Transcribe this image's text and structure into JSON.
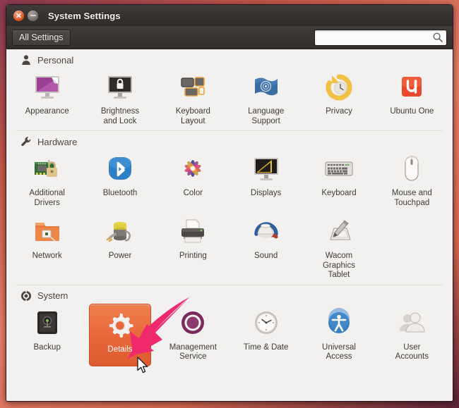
{
  "window": {
    "title": "System Settings",
    "close_label": "Close",
    "minimize_label": "Minimize"
  },
  "toolbar": {
    "all_settings_label": "All Settings",
    "search_value": "",
    "search_placeholder": "",
    "search_icon": "search-icon"
  },
  "sections": [
    {
      "id": "personal",
      "title": "Personal",
      "icon": "person-icon",
      "items": [
        {
          "label": "Appearance",
          "icon": "appearance-icon",
          "selected": false
        },
        {
          "label": "Brightness\nand Lock",
          "icon": "brightness-lock-icon",
          "selected": false
        },
        {
          "label": "Keyboard\nLayout",
          "icon": "keyboard-layout-icon",
          "selected": false
        },
        {
          "label": "Language\nSupport",
          "icon": "language-support-icon",
          "selected": false
        },
        {
          "label": "Privacy",
          "icon": "privacy-icon",
          "selected": false
        },
        {
          "label": "Ubuntu One",
          "icon": "ubuntu-one-icon",
          "selected": false
        }
      ]
    },
    {
      "id": "hardware",
      "title": "Hardware",
      "icon": "wrench-icon",
      "items": [
        {
          "label": "Additional\nDrivers",
          "icon": "additional-drivers-icon",
          "selected": false
        },
        {
          "label": "Bluetooth",
          "icon": "bluetooth-icon",
          "selected": false
        },
        {
          "label": "Color",
          "icon": "color-icon",
          "selected": false
        },
        {
          "label": "Displays",
          "icon": "displays-icon",
          "selected": false
        },
        {
          "label": "Keyboard",
          "icon": "keyboard-icon",
          "selected": false
        },
        {
          "label": "Mouse and\nTouchpad",
          "icon": "mouse-touchpad-icon",
          "selected": false
        },
        {
          "label": "Network",
          "icon": "network-icon",
          "selected": false
        },
        {
          "label": "Power",
          "icon": "power-icon",
          "selected": false
        },
        {
          "label": "Printing",
          "icon": "printing-icon",
          "selected": false
        },
        {
          "label": "Sound",
          "icon": "sound-icon",
          "selected": false
        },
        {
          "label": "Wacom\nGraphics\nTablet",
          "icon": "wacom-tablet-icon",
          "selected": false
        }
      ]
    },
    {
      "id": "system",
      "title": "System",
      "icon": "system-icon",
      "items": [
        {
          "label": "Backup",
          "icon": "backup-icon",
          "selected": false
        },
        {
          "label": "Details",
          "icon": "details-gear-icon",
          "selected": true
        },
        {
          "label": "Management\nService",
          "icon": "management-service-icon",
          "selected": false
        },
        {
          "label": "Time & Date",
          "icon": "time-date-icon",
          "selected": false
        },
        {
          "label": "Universal\nAccess",
          "icon": "universal-access-icon",
          "selected": false
        },
        {
          "label": "User\nAccounts",
          "icon": "user-accounts-icon",
          "selected": false
        }
      ]
    }
  ],
  "annotation": {
    "arrow_icon": "annotation-arrow-icon",
    "arrow_color": "#ee2a6c",
    "cursor_icon": "mouse-pointer-icon",
    "target_label": "Details"
  },
  "colors": {
    "selection_orange": "#e8663a",
    "titlebar": "#36322f",
    "content_background": "#f2f1ef",
    "window_frame": "#2f1424"
  }
}
